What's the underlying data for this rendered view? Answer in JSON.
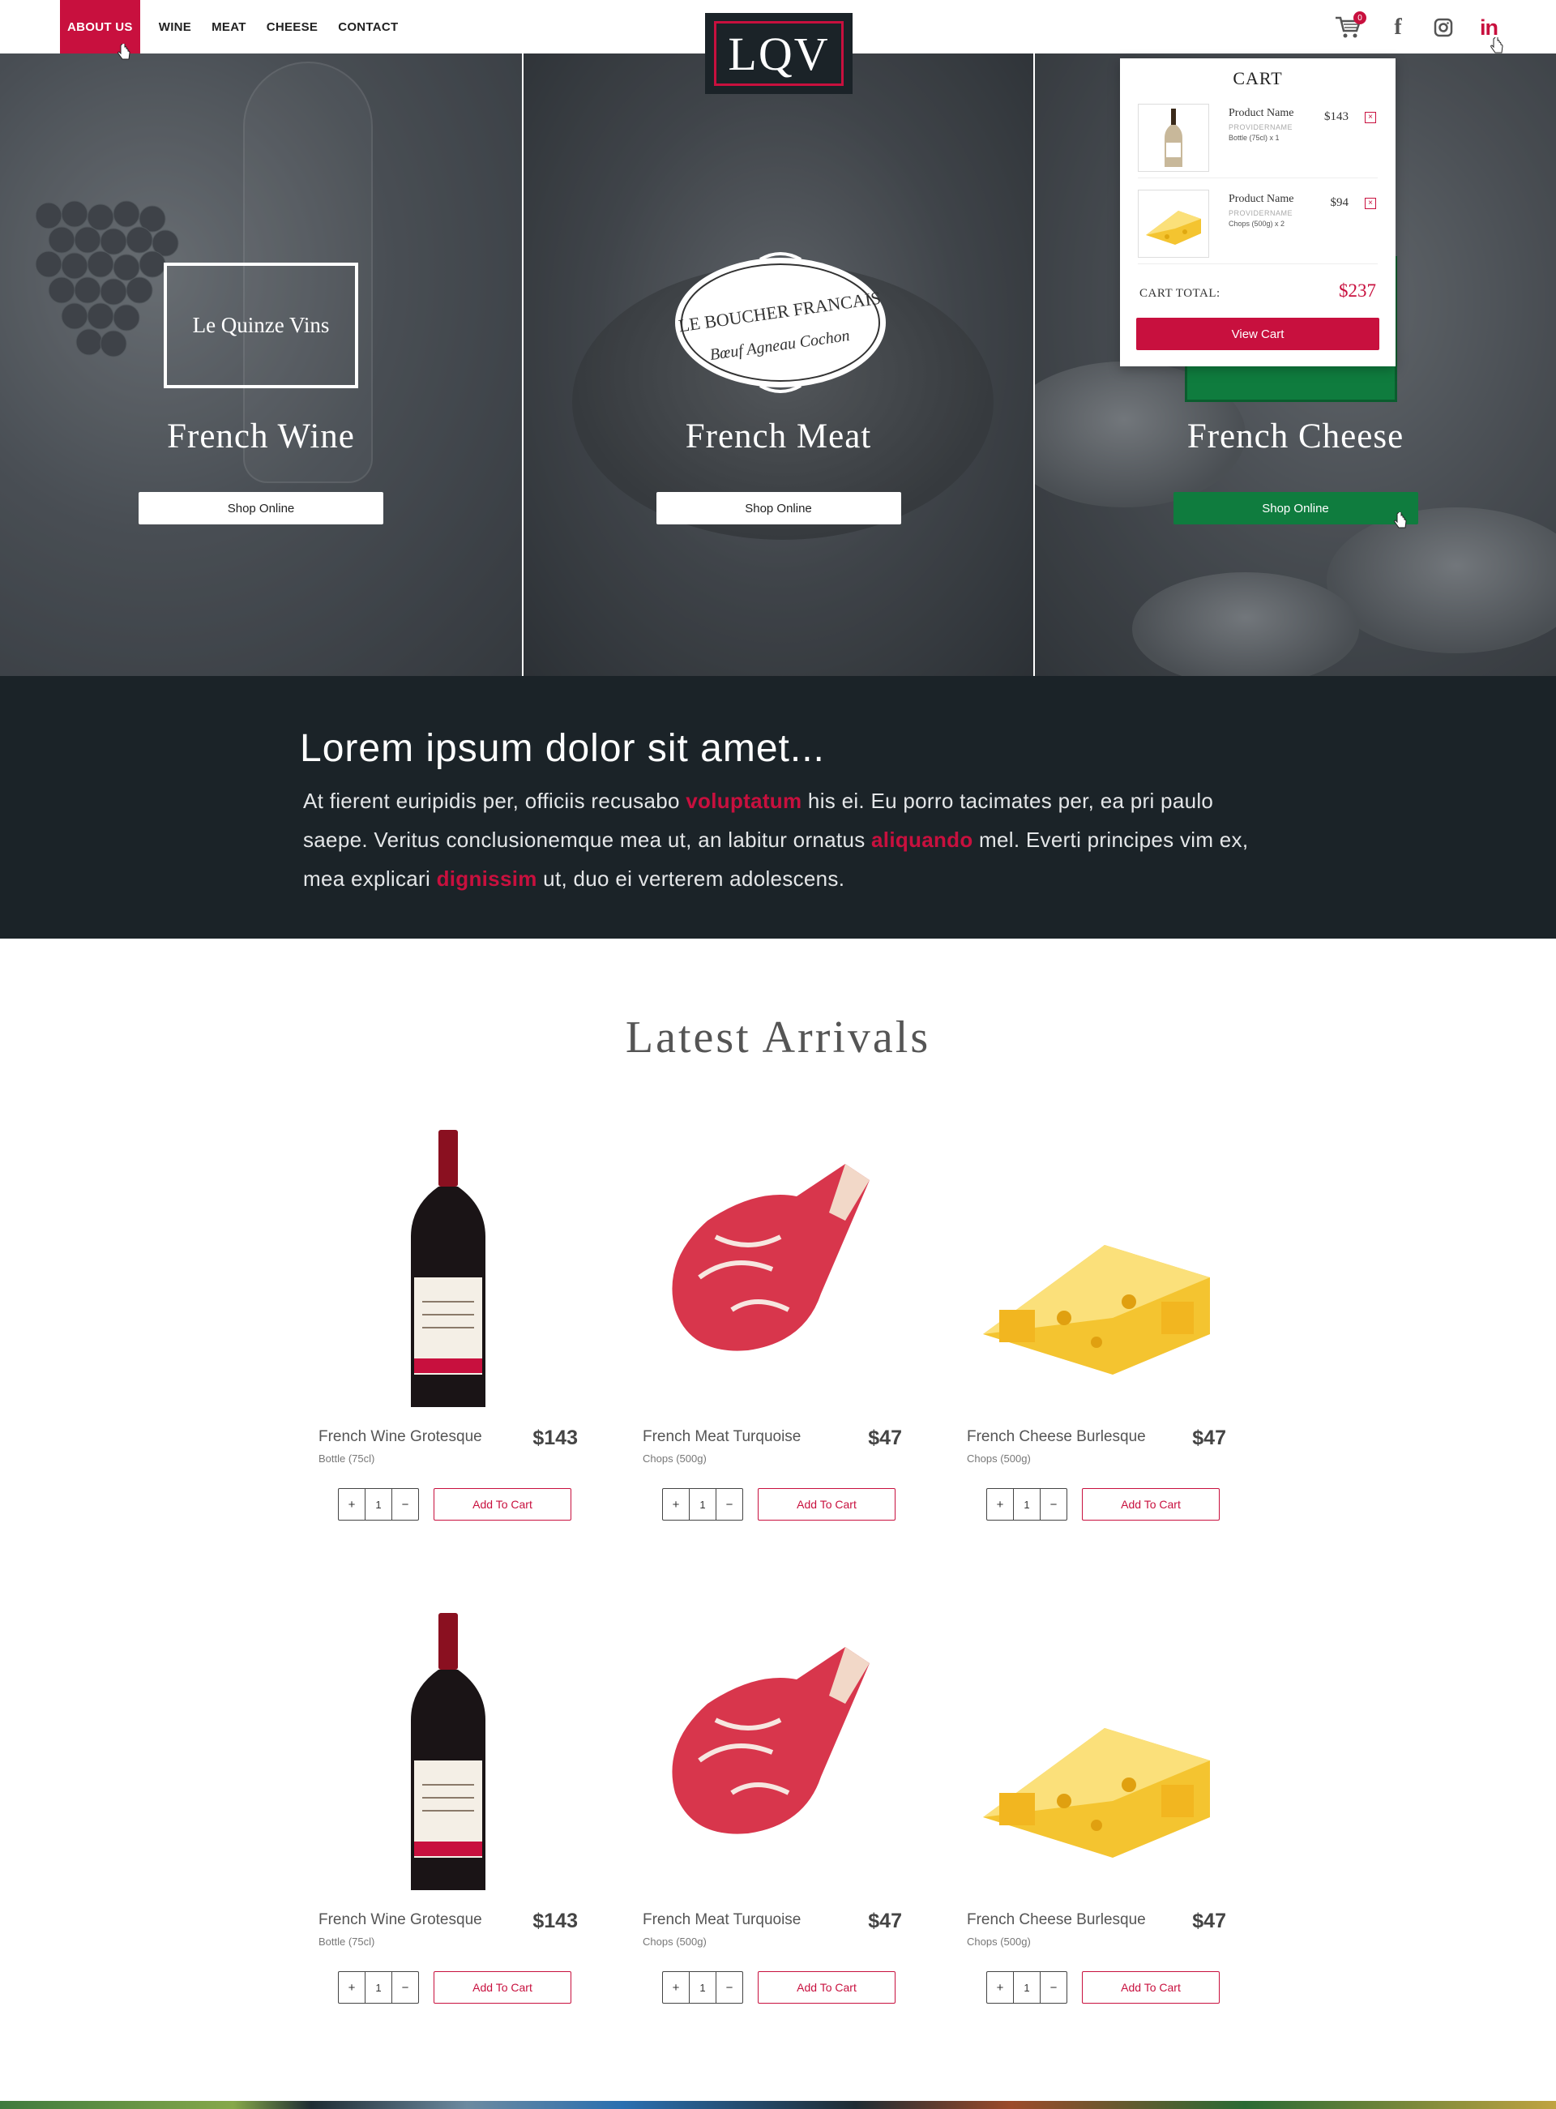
{
  "nav": {
    "links": [
      "ABOUT US",
      "WINE",
      "MEAT",
      "CHEESE",
      "CONTACT"
    ],
    "logo": "LQV",
    "cart_count": "0"
  },
  "hero": {
    "wine": {
      "mark": "Le Quinze Vins",
      "title": "French Wine",
      "button": "Shop Online"
    },
    "meat": {
      "mark_top": "LE BOUCHER FRANCAIS",
      "mark_bottom": "Bœuf Agneau Cochon",
      "title": "French Meat",
      "button": "Shop Online"
    },
    "cheese": {
      "title": "French Cheese",
      "button": "Shop Online"
    }
  },
  "cart": {
    "title": "CART",
    "items": [
      {
        "name": "Product Name",
        "provider": "PROVIDERNAME",
        "qty": "Bottle (75cl) x 1",
        "price": "$143",
        "remove": "×"
      },
      {
        "name": "Product Name",
        "provider": "PROVIDERNAME",
        "qty": "Chops (500g) x 2",
        "price": "$94",
        "remove": "×"
      }
    ],
    "total_label": "CART TOTAL:",
    "total_value": "$237",
    "view_button": "View Cart"
  },
  "intro": {
    "title": "Lorem ipsum dolor sit amet...",
    "p1": "At fierent euripidis per, officiis recusabo ",
    "h1": "voluptatum",
    "p2": " his ei. Eu porro tacimates per, ea pri paulo saepe. Veritus conclusionemque mea ut, an labitur ornatus ",
    "h2": "aliquando",
    "p3": " mel. Everti principes vim ex, mea explicari ",
    "h3": "dignissim",
    "p4": " ut, duo ei verterem adolescens."
  },
  "latest": {
    "title": "Latest Arrivals",
    "products": [
      {
        "name": "French Wine Grotesque",
        "unit": "Bottle (75cl)",
        "price": "$143",
        "qty": "1",
        "plus": "+",
        "minus": "−",
        "button": "Add To Cart",
        "kind": "wine"
      },
      {
        "name": "French Meat Turquoise",
        "unit": "Chops (500g)",
        "price": "$47",
        "qty": "1",
        "plus": "+",
        "minus": "−",
        "button": "Add To Cart",
        "kind": "meat"
      },
      {
        "name": "French Cheese Burlesque",
        "unit": "Chops (500g)",
        "price": "$47",
        "qty": "1",
        "plus": "+",
        "minus": "−",
        "button": "Add To Cart",
        "kind": "cheese"
      },
      {
        "name": "French Wine Grotesque",
        "unit": "Bottle (75cl)",
        "price": "$143",
        "qty": "1",
        "plus": "+",
        "minus": "−",
        "button": "Add To Cart",
        "kind": "wine"
      },
      {
        "name": "French Meat Turquoise",
        "unit": "Chops (500g)",
        "price": "$47",
        "qty": "1",
        "plus": "+",
        "minus": "−",
        "button": "Add To Cart",
        "kind": "meat"
      },
      {
        "name": "French Cheese Burlesque",
        "unit": "Chops (500g)",
        "price": "$47",
        "qty": "1",
        "plus": "+",
        "minus": "−",
        "button": "Add To Cart",
        "kind": "cheese"
      }
    ]
  },
  "colors": {
    "accent": "#c8103e",
    "dark": "#1b2328",
    "green": "#0f7c3e"
  }
}
